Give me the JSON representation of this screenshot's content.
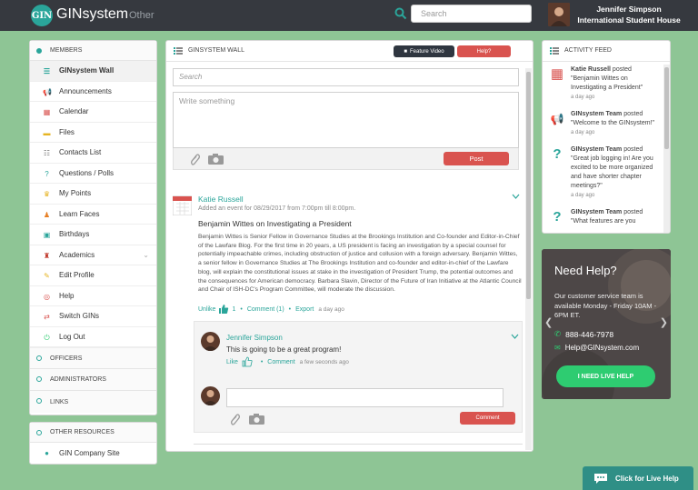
{
  "header": {
    "logo_text": "GIN",
    "brand": "GINsystem",
    "brand_sub": "Other",
    "search_placeholder": "Search",
    "user_line1": "Jennifer Simpson",
    "user_line2": "International Student House"
  },
  "sidebar": {
    "members_label": "MEMBERS",
    "items": [
      {
        "label": "GINsystem Wall",
        "icon": "list-icon"
      },
      {
        "label": "Announcements",
        "icon": "megaphone-icon"
      },
      {
        "label": "Calendar",
        "icon": "calendar-icon"
      },
      {
        "label": "Files",
        "icon": "folder-icon"
      },
      {
        "label": "Contacts List",
        "icon": "contact-icon"
      },
      {
        "label": "Questions / Polls",
        "icon": "question-icon"
      },
      {
        "label": "My Points",
        "icon": "trophy-icon"
      },
      {
        "label": "Learn Faces",
        "icon": "person-icon"
      },
      {
        "label": "Birthdays",
        "icon": "gift-icon"
      },
      {
        "label": "Academics",
        "icon": "graduation-icon"
      },
      {
        "label": "Edit Profile",
        "icon": "pencil-icon"
      },
      {
        "label": "Help",
        "icon": "lifebuoy-icon"
      },
      {
        "label": "Switch GINs",
        "icon": "switch-icon"
      },
      {
        "label": "Log Out",
        "icon": "power-icon"
      }
    ],
    "sections": [
      "OFFICERS",
      "ADMINISTRATORS",
      "LINKS"
    ],
    "other_resources": "OTHER RESOURCES",
    "company_site": "GIN Company Site"
  },
  "wall": {
    "title": "GINSYSTEM WALL",
    "feature_video": "Feature Video",
    "help": "Help?",
    "search_placeholder": "Search",
    "write_placeholder": "Write something",
    "post_button": "Post",
    "post": {
      "author": "Katie Russell",
      "meta": "Added an event for 08/29/2017 from 7:00pm till 8:00pm.",
      "title": "Benjamin Wittes on Investigating a President",
      "body": "Benjamin Wittes is Senior Fellow in Governance Studies at the Brookings Institution and Co-founder and Editor-in-Chief of the Lawfare Blog. For the first time in 20 years, a US president is facing an investigation by a special counsel for potentially impeachable crimes, including obstruction of justice and collusion with a foreign adversary. Benjamin Wittes, a senior fellow in Governance Studies at The Brookings Institution and co-founder and editor-in-chief of the Lawfare blog, will explain the constitutional issues at stake in the investigation of President Trump, the potential outcomes and the consequences for American democracy. Barbara Slavin, Director of the Future of Iran Initiative at the Atlantic Council and Chair of ISH-DC's Program Committee, will moderate the discussion.",
      "unlike": "Unlike",
      "like_count": "1",
      "comment_link": "Comment (1)",
      "export": "Export",
      "time": "a day ago"
    },
    "comment": {
      "author": "Jennifer Simpson",
      "text": "This is going to be a great program!",
      "like": "Like",
      "comment": "Comment",
      "time": "a few seconds ago"
    },
    "comment_button": "Comment"
  },
  "activity": {
    "title": "ACTIVITY FEED",
    "items": [
      {
        "name": "Katie Russell",
        "verb": "posted",
        "quote": "\"Benjamin Wittes on Investigating a President\"",
        "time": "a day ago",
        "icon": "calendar-icon"
      },
      {
        "name": "GINsystem Team",
        "verb": "posted",
        "quote": "\"Welcome to the GINsystem!\"",
        "time": "a day ago",
        "icon": "megaphone-icon"
      },
      {
        "name": "GINsystem Team",
        "verb": "posted",
        "quote": "\"Great job logging in! Are you excited to be more organized and have shorter chapter meetings?\"",
        "time": "a day ago",
        "icon": "question-icon"
      },
      {
        "name": "GINsystem Team",
        "verb": "posted",
        "quote": "\"What features are you",
        "time": "",
        "icon": "question-icon"
      }
    ]
  },
  "help_card": {
    "title": "Need Help?",
    "text": "Our customer service team is available Monday - Friday 10AM - 6PM ET.",
    "phone": "888-446-7978",
    "email": "Help@GINsystem.com",
    "button": "I NEED LIVE HELP"
  },
  "live_help": "Click for Live Help",
  "colors": {
    "accent": "#2aa59a",
    "red": "#d9534f",
    "bg": "#8ec595",
    "dark": "#36393f"
  }
}
